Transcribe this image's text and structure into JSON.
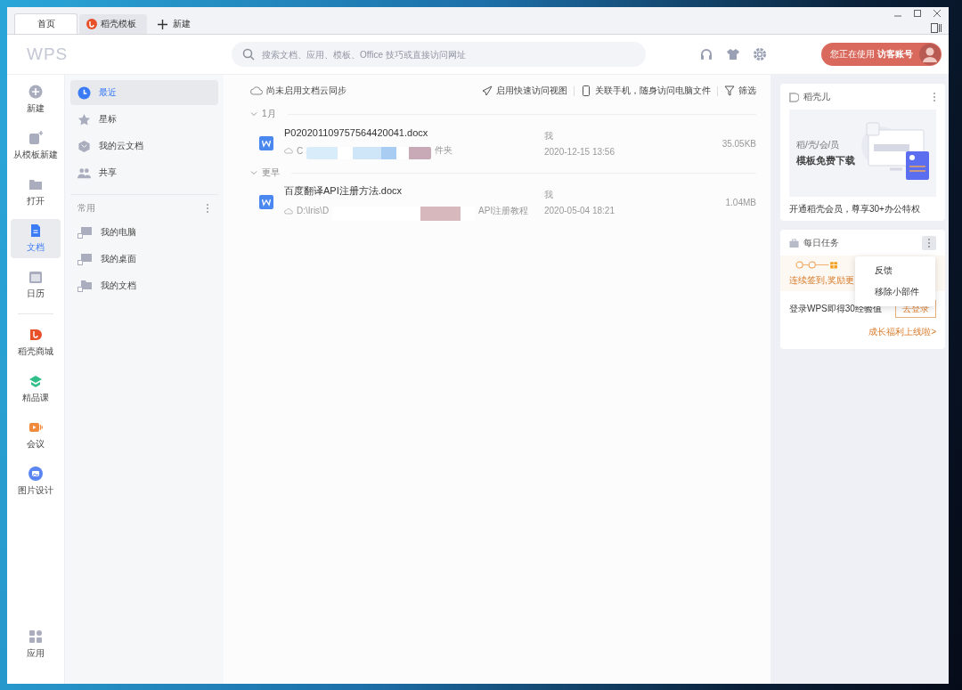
{
  "tabs": [
    {
      "label": "首页",
      "selected": true,
      "kind": "home"
    },
    {
      "label": "稻壳模板",
      "selected": false,
      "kind": "docer"
    }
  ],
  "new_tab": {
    "label": "新建"
  },
  "header": {
    "logo": "WPS",
    "search": {
      "placeholder": "搜索文档、应用、模板、Office 技巧或直接访问网址"
    },
    "account": {
      "prefix": "您正在使用",
      "name": "访客账号"
    }
  },
  "rail": {
    "top": [
      {
        "label": "新建",
        "kind": "plus",
        "selected": false
      },
      {
        "label": "从模板新建",
        "kind": "template",
        "selected": false
      },
      {
        "label": "打开",
        "kind": "folder",
        "selected": false
      },
      {
        "label": "文档",
        "kind": "doc",
        "selected": true
      },
      {
        "label": "日历",
        "kind": "calendar",
        "selected": false
      }
    ],
    "apps": [
      {
        "label": "稻壳商城",
        "kind": "docer",
        "selected": false
      },
      {
        "label": "精品课",
        "kind": "course",
        "selected": false
      },
      {
        "label": "会议",
        "kind": "meeting",
        "selected": false
      },
      {
        "label": "图片设计",
        "kind": "image",
        "selected": false
      }
    ],
    "bottom": {
      "label": "应用"
    }
  },
  "nav": {
    "items": [
      {
        "label": "最近",
        "kind": "clock",
        "selected": true
      },
      {
        "label": "星标",
        "kind": "star",
        "selected": false
      },
      {
        "label": "我的云文档",
        "kind": "cloud",
        "selected": false
      },
      {
        "label": "共享",
        "kind": "people",
        "selected": false
      }
    ],
    "section": {
      "title": "常用",
      "items": [
        {
          "label": "我的电脑",
          "kind": "pc"
        },
        {
          "label": "我的桌面",
          "kind": "pc"
        },
        {
          "label": "我的文档",
          "kind": "folder"
        }
      ]
    }
  },
  "toolbar": {
    "sync": "尚未启用文档云同步",
    "actions": [
      {
        "label": "启用快速访问视图",
        "kind": "plane"
      },
      {
        "label": "关联手机，随身访问电脑文件",
        "kind": "phone"
      },
      {
        "label": "筛选",
        "kind": "filter"
      }
    ]
  },
  "groups": [
    {
      "title": "1月",
      "expanded": true,
      "files": [
        {
          "name": "P020201109757564420041.docx",
          "path_start": "C",
          "path_end": "件夹",
          "owner": "我",
          "time": "2020-12-15 13:56",
          "size": "35.05KB"
        }
      ]
    },
    {
      "title": "更早",
      "expanded": true,
      "files": [
        {
          "name": "百度翻译API注册方法.docx",
          "path_start": "D:\\Iris\\D",
          "path_end": "API注册教程",
          "owner": "我",
          "time": "2020-05-04 18:21",
          "size": "1.04MB"
        }
      ]
    }
  ],
  "docer_card": {
    "title": "稻壳儿",
    "banner_small": "稻/壳/会/员",
    "banner_big": "模板免费下载",
    "caption": "开通稻壳会员，尊享30+办公特权"
  },
  "task_card": {
    "title": "每日任务",
    "streak": "连续签到,奖励更",
    "login_text": "登录WPS即得30经验值",
    "login_button": "去登录",
    "link": "成长福利上线啦>"
  },
  "menu": {
    "items": [
      "反馈",
      "移除小部件"
    ]
  }
}
